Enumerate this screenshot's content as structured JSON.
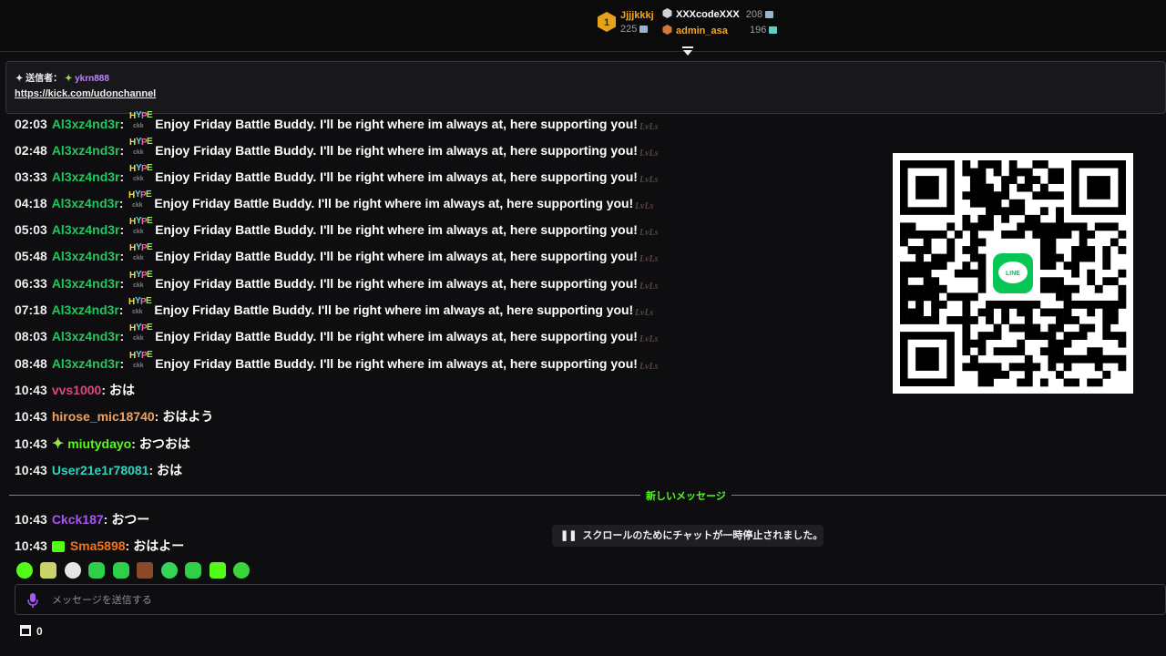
{
  "leaderboard": {
    "first": {
      "rank": "1",
      "name": "Jjjjkkkj",
      "points": "225",
      "name_color": "#f5a623"
    },
    "second": {
      "name": "XXXcodeXXX",
      "points": "208",
      "name_color": "#ffffff"
    },
    "third": {
      "name": "admin_asa",
      "points": "196",
      "name_color": "#f5a623"
    }
  },
  "pinned": {
    "sender_label": "送信者：",
    "sender_name": "ykrn888",
    "sender_color": "#c084fc",
    "link": "https://kick.com/udonchannel"
  },
  "messages": [
    {
      "time": "02:03",
      "user": "Al3xz4nd3r",
      "color": "#22c55e",
      "text": "Enjoy Friday Battle Buddy. I'll be right where im always at, here supporting you!",
      "hype": true
    },
    {
      "time": "02:48",
      "user": "Al3xz4nd3r",
      "color": "#22c55e",
      "text": "Enjoy Friday Battle Buddy. I'll be right where im always at, here supporting you!",
      "hype": true
    },
    {
      "time": "03:33",
      "user": "Al3xz4nd3r",
      "color": "#22c55e",
      "text": "Enjoy Friday Battle Buddy. I'll be right where im always at, here supporting you!",
      "hype": true
    },
    {
      "time": "04:18",
      "user": "Al3xz4nd3r",
      "color": "#22c55e",
      "text": "Enjoy Friday Battle Buddy. I'll be right where im always at, here supporting you!",
      "hype": true
    },
    {
      "time": "05:03",
      "user": "Al3xz4nd3r",
      "color": "#22c55e",
      "text": "Enjoy Friday Battle Buddy. I'll be right where im always at, here supporting you!",
      "hype": true
    },
    {
      "time": "05:48",
      "user": "Al3xz4nd3r",
      "color": "#22c55e",
      "text": "Enjoy Friday Battle Buddy. I'll be right where im always at, here supporting you!",
      "hype": true
    },
    {
      "time": "06:33",
      "user": "Al3xz4nd3r",
      "color": "#22c55e",
      "text": "Enjoy Friday Battle Buddy. I'll be right where im always at, here supporting you!",
      "hype": true
    },
    {
      "time": "07:18",
      "user": "Al3xz4nd3r",
      "color": "#22c55e",
      "text": "Enjoy Friday Battle Buddy. I'll be right where im always at, here supporting you!",
      "hype": true
    },
    {
      "time": "08:03",
      "user": "Al3xz4nd3r",
      "color": "#22c55e",
      "text": "Enjoy Friday Battle Buddy. I'll be right where im always at, here supporting you!",
      "hype": true
    },
    {
      "time": "08:48",
      "user": "Al3xz4nd3r",
      "color": "#22c55e",
      "text": "Enjoy Friday Battle Buddy. I'll be right where im always at, here supporting you!",
      "hype": true
    },
    {
      "time": "10:43",
      "user": "vvs1000",
      "color": "#e0457b",
      "text": "おは"
    },
    {
      "time": "10:43",
      "user": "hirose_mic18740",
      "color": "#f5a05a",
      "text": "おはよう"
    },
    {
      "time": "10:43",
      "user": "miutydayo",
      "color": "#53fc18",
      "text": "おつおは",
      "badge": "sparkle"
    },
    {
      "time": "10:43",
      "user": "User21e1r78081",
      "color": "#2dd4bf",
      "text": "おは"
    },
    {
      "time": "10:43",
      "user": "Ckck187",
      "color": "#a855f7",
      "text": "おつー"
    },
    {
      "time": "10:43",
      "user": "Sma5898",
      "color": "#f97316",
      "text": "おはよー",
      "badge": "gift"
    }
  ],
  "new_messages_label": "新しいメッセージ",
  "paused_notice": "スクロールのためにチャットが一時停止されました。",
  "input": {
    "placeholder": "メッセージを送信する"
  },
  "bottom": {
    "count": "0"
  },
  "qr": {
    "center_label": "LINE"
  },
  "colors": {
    "accent": "#53fc18",
    "background": "#0e0e10"
  }
}
